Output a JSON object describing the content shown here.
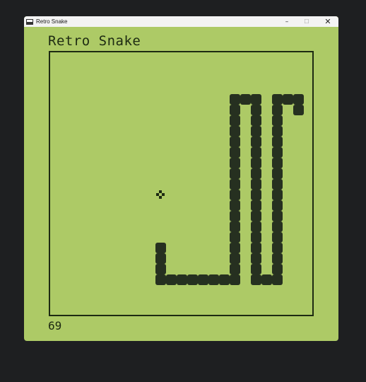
{
  "window": {
    "title": "Retro Snake",
    "controls": {
      "minimize": "–",
      "maximize": "☐",
      "close": "✕"
    }
  },
  "game": {
    "title": "Retro Snake",
    "score": "69",
    "colors": {
      "background": "#adca66",
      "snake": "#263020",
      "ink": "#1d2a12"
    },
    "food_cell": [
      10,
      13
    ],
    "snake_cells": [
      [
        10,
        18
      ],
      [
        10,
        19
      ],
      [
        10,
        20
      ],
      [
        10,
        21
      ],
      [
        11,
        21
      ],
      [
        12,
        21
      ],
      [
        13,
        21
      ],
      [
        14,
        21
      ],
      [
        15,
        21
      ],
      [
        16,
        21
      ],
      [
        17,
        21
      ],
      [
        17,
        20
      ],
      [
        17,
        19
      ],
      [
        17,
        18
      ],
      [
        17,
        17
      ],
      [
        17,
        16
      ],
      [
        17,
        15
      ],
      [
        17,
        14
      ],
      [
        17,
        13
      ],
      [
        17,
        12
      ],
      [
        17,
        11
      ],
      [
        17,
        10
      ],
      [
        17,
        9
      ],
      [
        17,
        8
      ],
      [
        17,
        7
      ],
      [
        17,
        6
      ],
      [
        17,
        5
      ],
      [
        17,
        4
      ],
      [
        18,
        4
      ],
      [
        19,
        4
      ],
      [
        19,
        5
      ],
      [
        19,
        6
      ],
      [
        19,
        7
      ],
      [
        19,
        8
      ],
      [
        19,
        9
      ],
      [
        19,
        10
      ],
      [
        19,
        11
      ],
      [
        19,
        12
      ],
      [
        19,
        13
      ],
      [
        19,
        14
      ],
      [
        19,
        15
      ],
      [
        19,
        16
      ],
      [
        19,
        17
      ],
      [
        19,
        18
      ],
      [
        19,
        19
      ],
      [
        19,
        20
      ],
      [
        19,
        21
      ],
      [
        20,
        21
      ],
      [
        21,
        21
      ],
      [
        21,
        20
      ],
      [
        21,
        19
      ],
      [
        21,
        18
      ],
      [
        21,
        17
      ],
      [
        21,
        16
      ],
      [
        21,
        15
      ],
      [
        21,
        14
      ],
      [
        21,
        13
      ],
      [
        21,
        12
      ],
      [
        21,
        11
      ],
      [
        21,
        10
      ],
      [
        21,
        9
      ],
      [
        21,
        8
      ],
      [
        21,
        7
      ],
      [
        21,
        6
      ],
      [
        21,
        5
      ],
      [
        21,
        4
      ],
      [
        22,
        4
      ],
      [
        23,
        4
      ],
      [
        23,
        5
      ]
    ]
  }
}
